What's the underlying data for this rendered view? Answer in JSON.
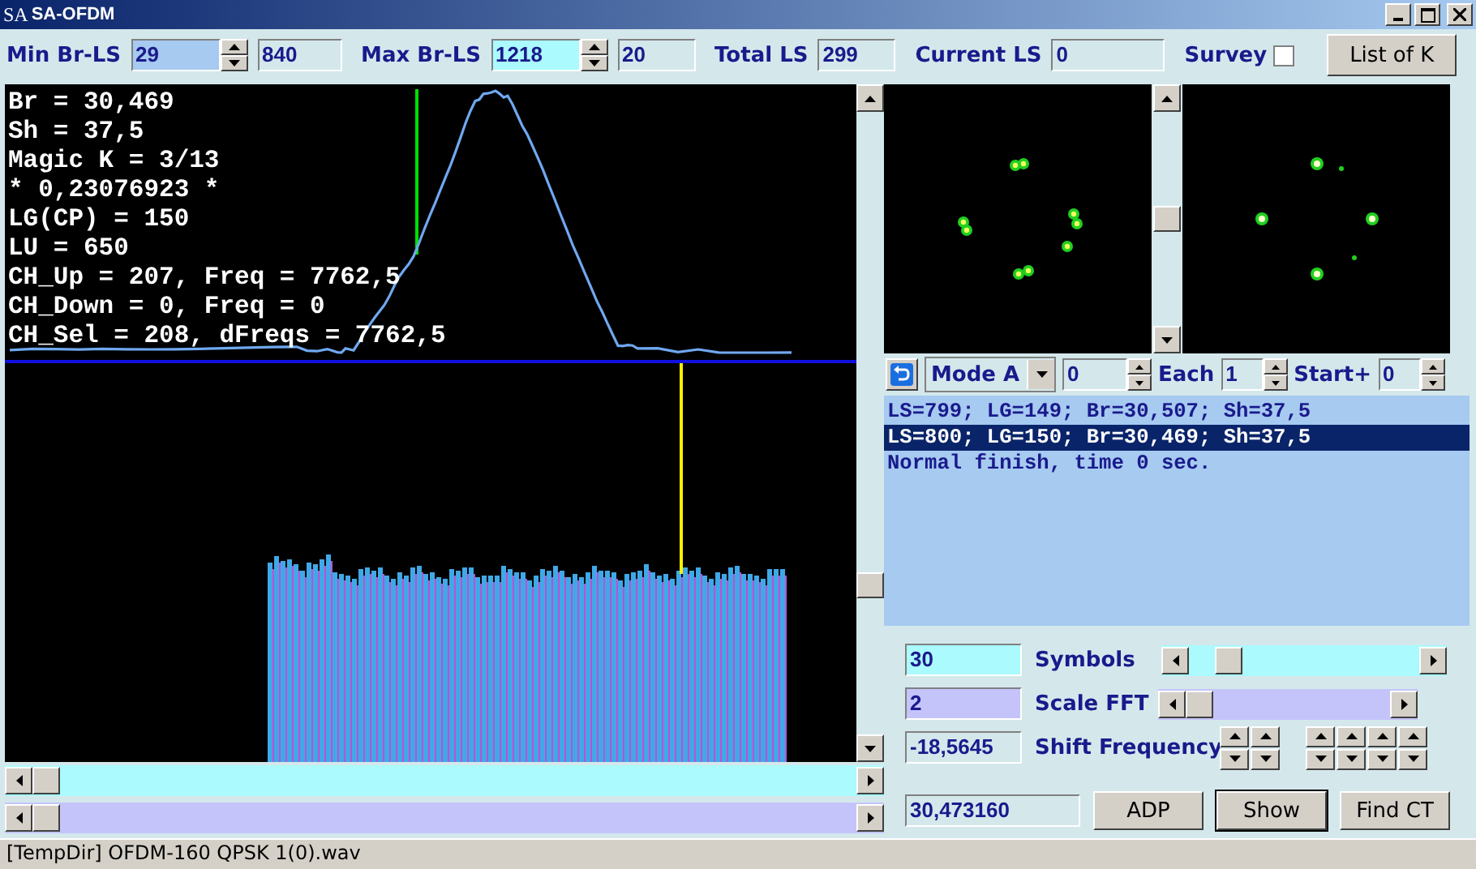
{
  "window": {
    "title": "SA-OFDM",
    "icon_letters": "SA"
  },
  "toolbar": {
    "min_br_ls": {
      "label": "Min Br-LS",
      "value": "29",
      "extra": "840"
    },
    "max_br_ls": {
      "label": "Max Br-LS",
      "value": "1218",
      "extra": "20"
    },
    "total_ls": {
      "label": "Total LS",
      "value": "299"
    },
    "current_ls": {
      "label": "Current LS",
      "value": "0"
    },
    "survey": {
      "label": "Survey",
      "checked": false
    },
    "list_button": "List of K"
  },
  "readout": [
    "Br = 30,469",
    "Sh = 37,5",
    "Magic K = 3/13",
    "* 0,23076923 *",
    "LG(CP) = 150",
    "LU = 650",
    "CH_Up = 207, Freq = 7762,5",
    "CH_Down = 0, Freq = 0",
    "CH_Sel = 208, dFreqs = 7762,5"
  ],
  "mode_row": {
    "mode": "Mode A",
    "value": "0",
    "each_label": "Each",
    "each": "1",
    "start_label": "Start+",
    "start": "0"
  },
  "log": [
    {
      "text": "LS=799; LG=149; Br=30,507; Sh=37,5",
      "selected": false
    },
    {
      "text": "LS=800; LG=150; Br=30,469; Sh=37,5",
      "selected": true
    },
    {
      "text": "Normal finish, time 0 sec.",
      "selected": false
    }
  ],
  "controls": {
    "symbols": {
      "value": "30",
      "label": "Symbols"
    },
    "scale_fft": {
      "value": "2",
      "label": "Scale FFT"
    },
    "shift": {
      "value": "-18,5645",
      "label": "Shift Frequency"
    },
    "result": "30,473160",
    "buttons": [
      "ADP",
      "Show",
      "Find CT"
    ]
  },
  "status_bar": "[TempDir] OFDM-160 QPSK 1(0).wav"
}
